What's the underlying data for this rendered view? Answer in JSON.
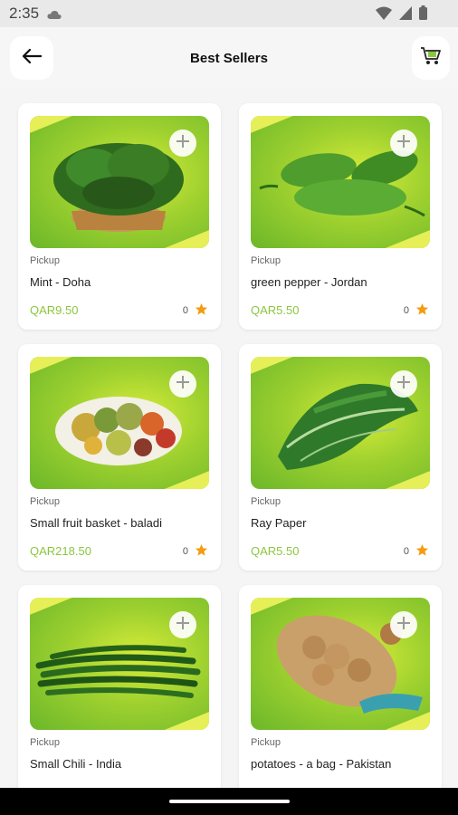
{
  "status_bar": {
    "time": "2:35"
  },
  "header": {
    "title": "Best Sellers"
  },
  "colors": {
    "accent": "#8cc63f",
    "star": "#f39c12",
    "image_bg": "#9fd12f"
  },
  "products": [
    {
      "channel": "Pickup",
      "name": "Mint - Doha",
      "price": "QAR9.50",
      "rating": "0",
      "image": "mint-basket"
    },
    {
      "channel": "Pickup",
      "name": "green pepper - Jordan",
      "price": "QAR5.50",
      "rating": "0",
      "image": "green-peppers"
    },
    {
      "channel": "Pickup",
      "name": "Small fruit basket - baladi",
      "price": "QAR218.50",
      "rating": "0",
      "image": "fruit-basket"
    },
    {
      "channel": "Pickup",
      "name": "Ray Paper",
      "price": "QAR5.50",
      "rating": "0",
      "image": "leafy-greens"
    },
    {
      "channel": "Pickup",
      "name": "Small Chili - India",
      "price": "",
      "rating": "",
      "image": "green-chilies"
    },
    {
      "channel": "Pickup",
      "name": "potatoes - a bag - Pakistan",
      "price": "",
      "rating": "",
      "image": "potato-bag"
    }
  ]
}
